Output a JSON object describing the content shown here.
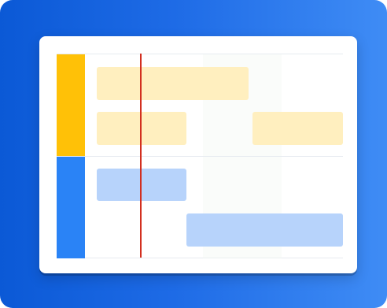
{
  "colors": {
    "background_start": "#0b59d6",
    "background_end": "#3f8cf5",
    "card": "#ffffff",
    "lane_1_accent": "#ffc107",
    "lane_1_task": "#ffefbf",
    "lane_2_accent": "#2a83f6",
    "lane_2_task": "#b7d3fb",
    "playhead": "#d22f1f"
  },
  "lanes": [
    {
      "color_key": "lane_1",
      "tasks": [
        {
          "row": 1
        },
        {
          "row": 2
        },
        {
          "row": 2
        }
      ]
    },
    {
      "color_key": "lane_2",
      "tasks": [
        {
          "row": 1
        },
        {
          "row": 2
        }
      ]
    }
  ]
}
